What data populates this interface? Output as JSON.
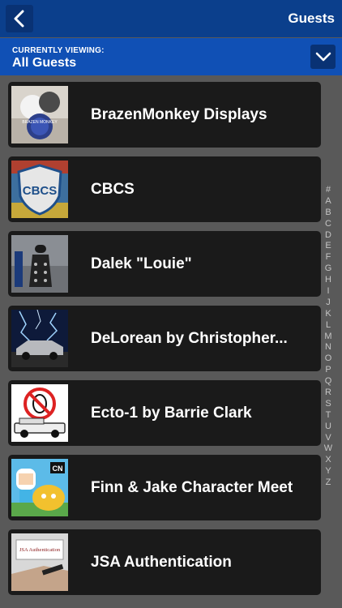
{
  "header": {
    "title": "Guests",
    "back_icon": "chevron-left-icon"
  },
  "filter": {
    "label": "CURRENTLY VIEWING:",
    "value": "All Guests",
    "dropdown_icon": "chevron-down-icon"
  },
  "guests": [
    {
      "name": "BrazenMonkey Displays",
      "thumb_text": "BRAZEN MONKEY"
    },
    {
      "name": "CBCS",
      "thumb_text": "CBCS"
    },
    {
      "name": "Dalek \"Louie\""
    },
    {
      "name": "DeLorean by Christopher..."
    },
    {
      "name": "Ecto-1 by Barrie Clark"
    },
    {
      "name": "Finn & Jake Character Meet",
      "thumb_text": "CN"
    },
    {
      "name": "JSA Authentication",
      "thumb_text": "JSA Authentication"
    }
  ],
  "index_letters": [
    "#",
    "A",
    "B",
    "C",
    "D",
    "E",
    "F",
    "G",
    "H",
    "I",
    "J",
    "K",
    "L",
    "M",
    "N",
    "O",
    "P",
    "Q",
    "R",
    "S",
    "T",
    "U",
    "V",
    "W",
    "X",
    "Y",
    "Z"
  ],
  "colors": {
    "top_bar": "#0b3f8c",
    "filter_bar": "#1050b5",
    "background": "#595959",
    "row": "#1a1a1a"
  }
}
